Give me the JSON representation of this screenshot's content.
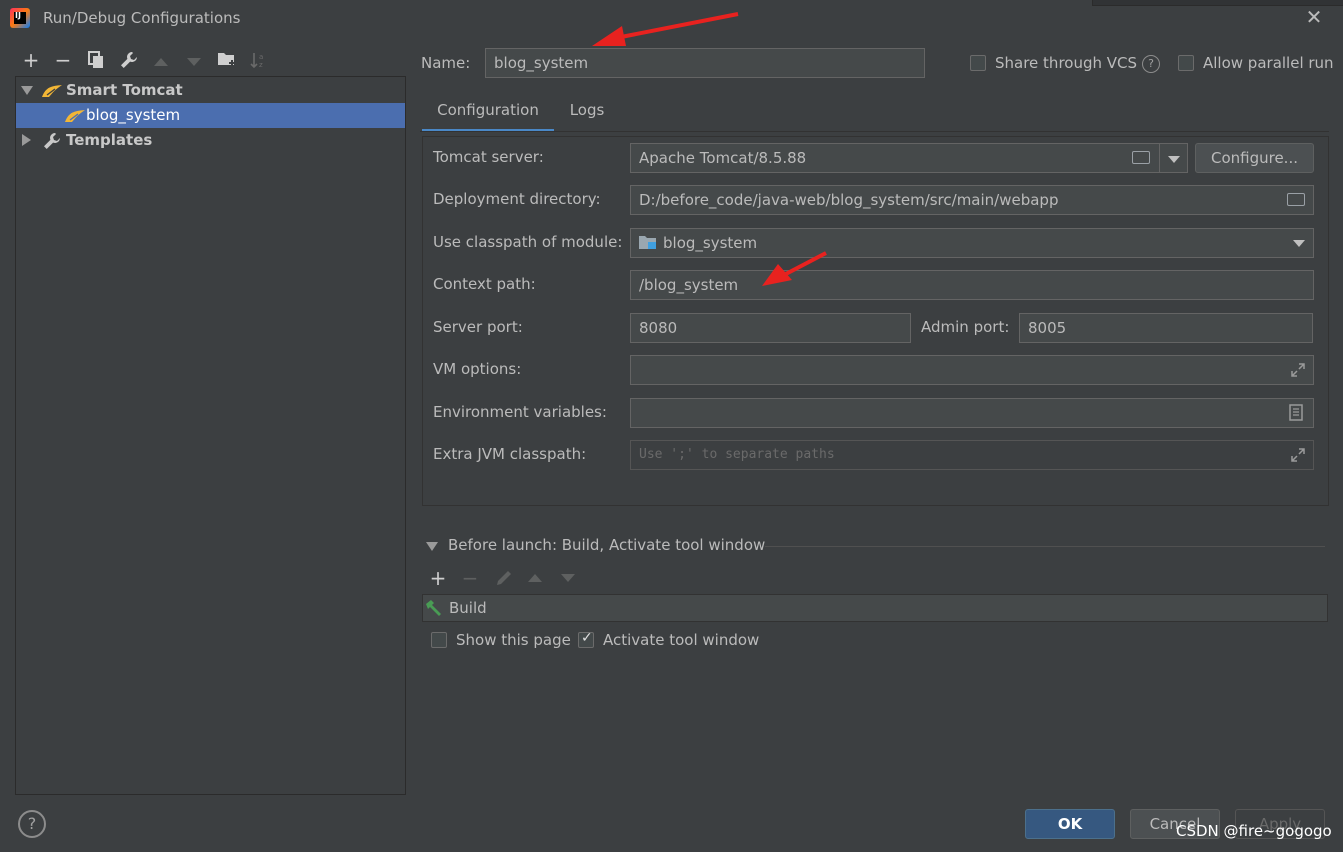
{
  "window": {
    "title": "Run/Debug Configurations",
    "app_logo_text": "IJ"
  },
  "toolbar": {
    "add": "+",
    "remove": "−"
  },
  "tree": {
    "group_label": "Smart Tomcat",
    "item_label": "blog_system",
    "templates_label": "Templates"
  },
  "name_row": {
    "label": "Name:",
    "value": "blog_system",
    "share_label": "Share through VCS",
    "share_checked": false,
    "parallel_label": "Allow parallel run",
    "parallel_checked": false
  },
  "tabs": [
    {
      "label": "Configuration",
      "active": true
    },
    {
      "label": "Logs",
      "active": false
    }
  ],
  "config": {
    "tomcat_server_label": "Tomcat server:",
    "tomcat_server_value": "Apache Tomcat/8.5.88",
    "configure_label": "Configure...",
    "deploy_dir_label": "Deployment directory:",
    "deploy_dir_value": "D:/before_code/java-web/blog_system/src/main/webapp",
    "classpath_label": "Use classpath of module:",
    "classpath_value": "blog_system",
    "context_path_label": "Context path:",
    "context_path_value": "/blog_system",
    "server_port_label": "Server port:",
    "server_port_value": "8080",
    "admin_port_label": "Admin port:",
    "admin_port_value": "8005",
    "vm_options_label": "VM options:",
    "vm_options_value": "",
    "env_vars_label": "Environment variables:",
    "env_vars_value": "",
    "extra_jvm_label": "Extra JVM classpath:",
    "extra_jvm_placeholder": "Use ';' to separate paths"
  },
  "before_launch": {
    "header": "Before launch: Build, Activate tool window",
    "build_label": "Build",
    "show_page_label": "Show this page",
    "show_page_checked": false,
    "activate_label": "Activate tool window",
    "activate_checked": true
  },
  "footer": {
    "help": "?",
    "ok_label": "OK",
    "cancel_label": "Cancel",
    "apply_label": "Apply"
  },
  "watermark": "CSDN @fire~gogogo",
  "colors": {
    "background": "#3c3f41",
    "selection": "#4b6eaf",
    "primary_button": "#365880",
    "annotation_arrow": "#e8221f"
  }
}
